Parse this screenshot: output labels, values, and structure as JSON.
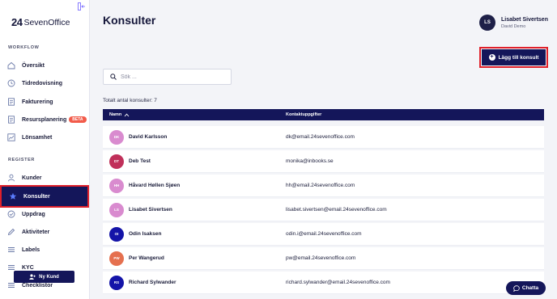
{
  "brand": {
    "logo_mark": "24",
    "logo_text": "SevenOffice"
  },
  "sidebar": {
    "section_workflow": "WORKFLOW",
    "section_register": "REGISTER",
    "items": [
      {
        "label": "Översikt",
        "icon": "home-icon"
      },
      {
        "label": "Tidredovisning",
        "icon": "clock-icon"
      },
      {
        "label": "Fakturering",
        "icon": "document-icon"
      },
      {
        "label": "Resursplanering",
        "icon": "document-icon",
        "badge": "BETA"
      },
      {
        "label": "Lönsamhet",
        "icon": "chart-icon"
      },
      {
        "label": "Kunder",
        "icon": "person-icon"
      },
      {
        "label": "Konsulter",
        "icon": "star-icon",
        "active": true
      },
      {
        "label": "Uppdrag",
        "icon": "check-circle-icon"
      },
      {
        "label": "Aktiviteter",
        "icon": "pencil-icon"
      },
      {
        "label": "Labels",
        "icon": "list-icon"
      },
      {
        "label": "KYC",
        "icon": "list-icon"
      },
      {
        "label": "Checklistor",
        "icon": "list-icon"
      }
    ],
    "new_customer_label": "Ny Kund"
  },
  "header": {
    "title": "Konsulter",
    "user": {
      "initials": "LS",
      "name": "Lisabet Sivertsen",
      "company": "David Demo"
    }
  },
  "toolbar": {
    "add_label": "Lägg till konsult"
  },
  "search": {
    "placeholder": "Sök ..."
  },
  "summary": {
    "total_label": "Totalt antal konsulter: 7"
  },
  "table": {
    "headers": {
      "name": "Namn",
      "contact": "Kontaktuppgifter"
    },
    "rows": [
      {
        "initials": "DK",
        "name": "David Karlsson",
        "contact": "dk@email.24sevenoffice.com",
        "color": "#d98bcf"
      },
      {
        "initials": "DT",
        "name": "Deb Test",
        "contact": "monika@inbooks.se",
        "color": "#c0305a"
      },
      {
        "initials": "HH",
        "name": "Håvard Høllen Sjøen",
        "contact": "hh@email.24sevenoffice.com",
        "color": "#d98bcf"
      },
      {
        "initials": "LS",
        "name": "Lisabet Sivertsen",
        "contact": "lisabet.sivertsen@email.24sevenoffice.com",
        "color": "#d98bcf"
      },
      {
        "initials": "OI",
        "name": "Odin Isaksen",
        "contact": "odin.i@email.24sevenoffice.com",
        "color": "#1414a8"
      },
      {
        "initials": "PW",
        "name": "Per Wangerud",
        "contact": "pw@email.24sevenoffice.com",
        "color": "#e5704f"
      },
      {
        "initials": "RS",
        "name": "Richard Sylwander",
        "contact": "richard.sylwander@email.24sevenoffice.com",
        "color": "#1414a8"
      }
    ]
  },
  "chat": {
    "label": "Chatta"
  },
  "colors": {
    "primary": "#14165a",
    "highlight": "#e0202a",
    "beta": "#f25b4a"
  }
}
